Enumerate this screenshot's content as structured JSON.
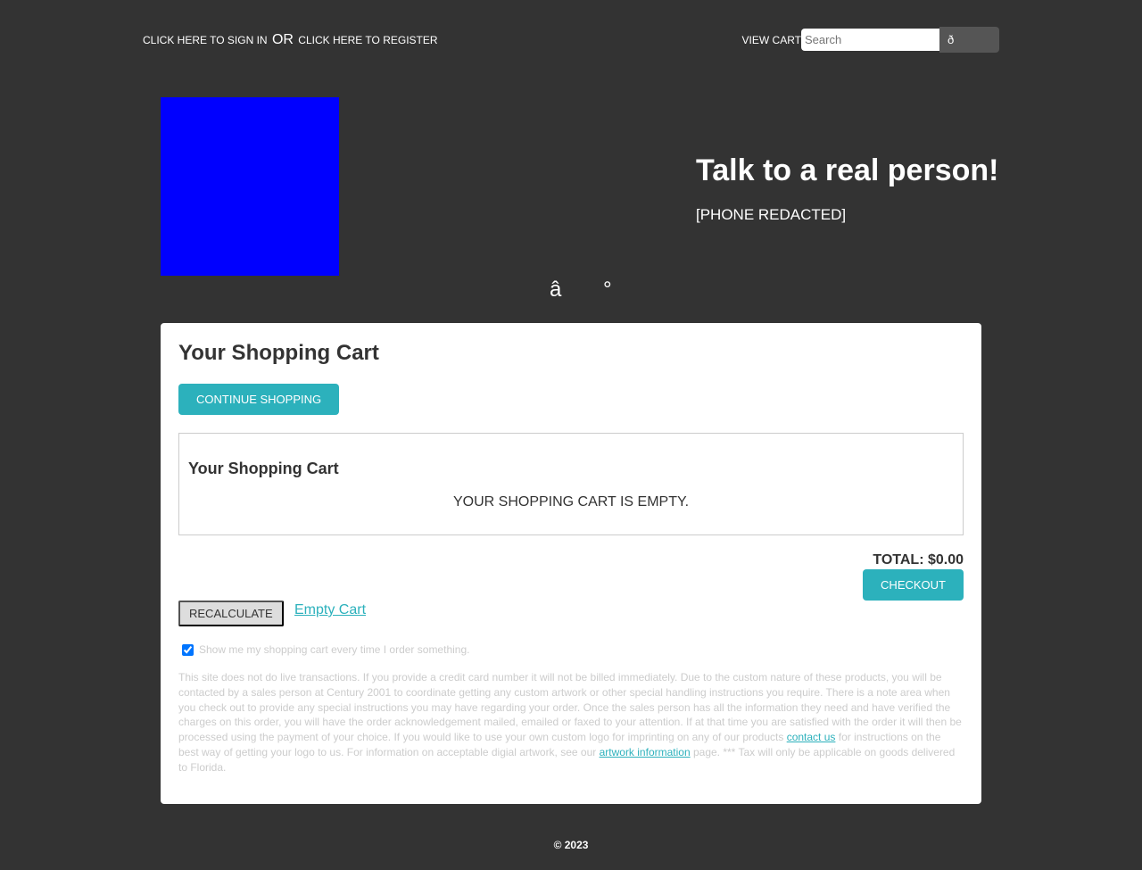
{
  "header": {
    "sign_in": "CLICK HERE TO SIGN IN",
    "or": "OR",
    "register": "CLICK HERE TO REGISTER",
    "view_cart": "VIEW CART",
    "search_placeholder": "Search",
    "search_button": "ð"
  },
  "hero": {
    "title": "Talk to a real person!",
    "phone": "[PHONE REDACTED]",
    "glyphs": "â °"
  },
  "cart": {
    "title": "Your Shopping Cart",
    "continue": "CONTINUE SHOPPING",
    "inner_title": "Your Shopping Cart",
    "empty_message": "YOUR SHOPPING CART IS EMPTY.",
    "total": "TOTAL: $0.00",
    "checkout": "CHECKOUT",
    "recalculate": "RECALCULATE",
    "empty_cart": "Empty Cart",
    "show_cart_label": "Show me my shopping cart every time I order something.",
    "note_1": "This site does not do live transactions. If you provide a credit card number it will not be billed immediately. Due to the custom nature of these products, you will be contacted by a sales person at Century 2001 to coordinate getting any custom artwork or other special handling instructions you require. There is a note area when you check out to provide any special instructions you may have regarding your order. Once the sales person has all the information they need and have verified the charges on this order, you will have the order acknowledgement mailed, emailed or faxed to your attention. If at that time you are satisfied with the order it will then be processed using the payment of your choice. If you would like to use your own custom logo for imprinting on any of our products ",
    "contact_link": "contact us",
    "note_2": " for instructions on the best way of getting your logo to us. For information on acceptable digial artwork, see our ",
    "artwork_link": "artwork information",
    "note_3": " page. *** Tax will only be applicable on goods delivered to Florida."
  },
  "footer": {
    "copyright": "© 2023"
  }
}
